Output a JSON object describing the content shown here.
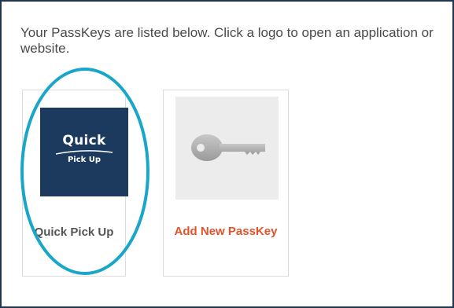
{
  "intro_text": "Your PassKeys are listed below. Click a logo to open an application or website.",
  "passkeys": [
    {
      "label": "Quick Pick Up",
      "logo": {
        "line1": "Quick",
        "line2": "Pick Up",
        "background_color": "#1c3a5e"
      }
    }
  ],
  "add_tile": {
    "label": "Add New PassKey",
    "icon": "key-icon",
    "label_color": "#e2532a"
  },
  "highlight": {
    "color": "#1aa6c9"
  },
  "colors": {
    "frame_border": "#1f3550",
    "text": "#4a4a4a"
  }
}
